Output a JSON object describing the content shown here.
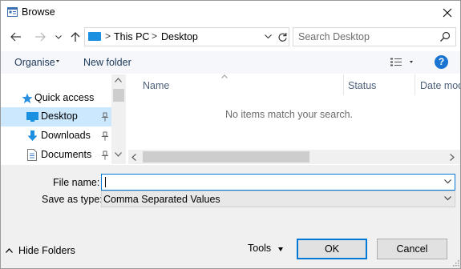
{
  "window": {
    "title": "Browse",
    "icon": "browse-dialog-icon",
    "close_icon": "close-icon"
  },
  "address": {
    "back_icon": "back-arrow-icon",
    "forward_icon": "forward-arrow-icon",
    "recent_icon": "chevron-down-icon",
    "up_icon": "up-arrow-icon",
    "location_icon": "this-pc-icon",
    "separator": ">",
    "segments": [
      "This PC",
      "Desktop"
    ],
    "refresh_icon": "refresh-icon"
  },
  "search": {
    "placeholder": "Search Desktop",
    "icon": "search-icon"
  },
  "toolbar": {
    "organise_label": "Organise",
    "new_folder_label": "New folder",
    "view_icon": "view-details-icon",
    "help_label": "?"
  },
  "nav": {
    "items": [
      {
        "label": "Quick access",
        "icon": "star-icon",
        "pinned": false,
        "selected": false
      },
      {
        "label": "Desktop",
        "icon": "desktop-icon",
        "pinned": true,
        "selected": true
      },
      {
        "label": "Downloads",
        "icon": "download-icon",
        "pinned": true,
        "selected": false
      },
      {
        "label": "Documents",
        "icon": "document-icon",
        "pinned": true,
        "selected": false
      }
    ]
  },
  "content": {
    "columns": [
      "Name",
      "Status",
      "Date mod"
    ],
    "empty_message": "No items match your search."
  },
  "form": {
    "filename_label": "File name:",
    "filename_value": "",
    "savetype_label": "Save as type:",
    "savetype_value": "Comma Separated Values"
  },
  "footer": {
    "hide_folders_label": "Hide Folders",
    "tools_label": "Tools",
    "ok_label": "OK",
    "cancel_label": "Cancel"
  },
  "colors": {
    "accent": "#0078d7",
    "selection": "#cce8ff",
    "help": "#1a74d2",
    "folder_blue": "#1b8fe0"
  }
}
